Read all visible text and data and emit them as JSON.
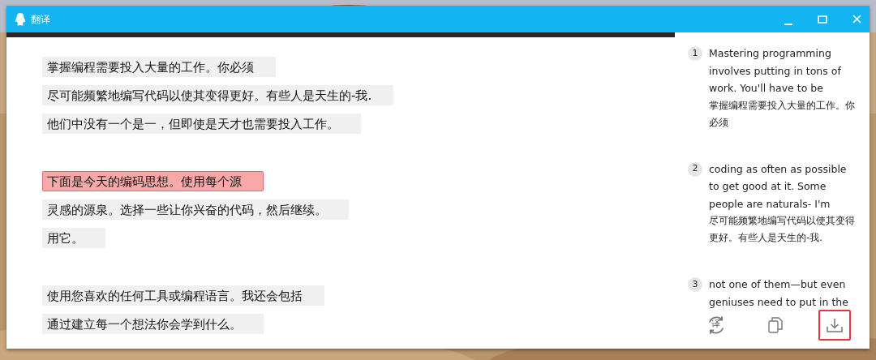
{
  "window": {
    "title": "翻译"
  },
  "source": {
    "paragraphs": [
      {
        "lines": [
          {
            "text": "掌握编程需要投入大量的工作。你必须",
            "selected": false
          },
          {
            "text": "尽可能频繁地编写代码以使其变得更好。有些人是天生的-我.",
            "selected": false
          },
          {
            "text": "他们中没有一个是一，但即使是天才也需要投入工作。",
            "selected": false
          }
        ]
      },
      {
        "lines": [
          {
            "text": "下面是今天的编码思想。使用每个源",
            "selected": true
          },
          {
            "text": "灵感的源泉。选择一些让你兴奋的代码，然后继续。",
            "selected": false
          },
          {
            "text": "用它。",
            "selected": false
          }
        ]
      },
      {
        "lines": [
          {
            "text": "使用您喜欢的任何工具或编程语言。我还会包括",
            "selected": false
          },
          {
            "text": "通过建立每一个想法你会学到什么。",
            "selected": false
          }
        ]
      }
    ]
  },
  "translations": [
    {
      "number": "1",
      "english": "Mastering programming involves putting in tons of work. You'll have to be",
      "chinese": "掌握编程需要投入大量的工作。你必须"
    },
    {
      "number": "2",
      "english": "coding as often as possible to get good at it. Some people are naturals- I'm",
      "chinese": "尽可能频繁地编写代码以使其变得更好。有些人是天生的-我."
    },
    {
      "number": "3",
      "english": "not one of them—but even geniuses need to put in the"
    }
  ],
  "toolbar": [
    {
      "kind": "translate",
      "glyph": "译",
      "selected": false
    },
    {
      "kind": "copy",
      "selected": false
    },
    {
      "kind": "download",
      "selected": true
    }
  ]
}
